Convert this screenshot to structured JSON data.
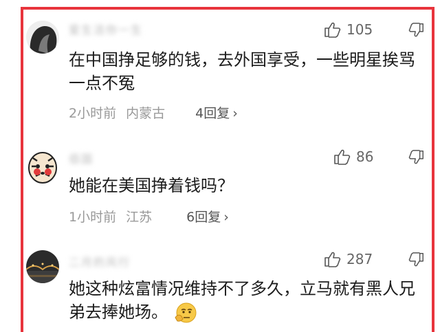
{
  "comments": [
    {
      "username": "爱生活你​一生",
      "likes": "105",
      "text": "在中国挣足够的钱，去外国享受，一些明星挨骂一点不冤",
      "time": "2小时前",
      "location": "内蒙古",
      "replies": "4回复",
      "avatar": "dark-hair-avatar"
    },
    {
      "username": "佰国",
      "likes": "86",
      "text": "她能在美国挣着钱吗？",
      "time": "1小时前",
      "location": "江苏",
      "replies": "6回复",
      "avatar": "tiger-avatar"
    },
    {
      "username": "二月的风行",
      "likes": "287",
      "text": "她这种炫富情况维持不了多久，立马就有黑人兄弟去捧她场。",
      "avatar": "night-bridge-avatar",
      "emoji": "thinking-face-emoji"
    }
  ],
  "accent_colors": {
    "frame": "#e8343c",
    "meta": "#999999",
    "text": "#1c1c1c"
  }
}
